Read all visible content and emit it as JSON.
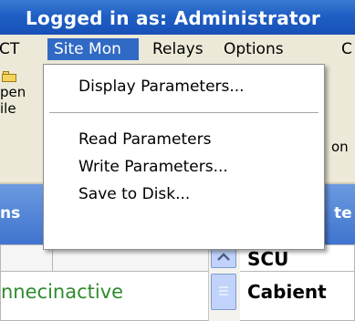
{
  "title_bar": {
    "text": "Logged in as: Administrator"
  },
  "menu_bar": {
    "items": [
      {
        "label": "CT",
        "active": false
      },
      {
        "label": "Site Mon",
        "active": true
      },
      {
        "label": "Relays",
        "active": false
      },
      {
        "label": "Options",
        "active": false
      },
      {
        "label": "C",
        "active": false
      }
    ]
  },
  "toolbar": {
    "open_button": {
      "line1": "pen",
      "line2": "ile",
      "icon": "folder-icon"
    },
    "right_button": {
      "label": "on"
    }
  },
  "grid": {
    "header_left": "ns",
    "header_right": "te",
    "row1": {
      "right": "SCU"
    },
    "row2": {
      "left": "nnecinactive",
      "right": "Cabient"
    },
    "scrollbar": {
      "up_icon": "arrow-up-icon",
      "thumb_icon": "scroll-grip-icon"
    },
    "colors": {
      "status_text": "#2e8b2e",
      "header": "#3f74cf"
    }
  },
  "dropdown": {
    "items": [
      {
        "label": "Display Parameters..."
      },
      {
        "label": "Read Parameters"
      },
      {
        "label": "Write Parameters..."
      },
      {
        "label": "Save to Disk..."
      }
    ]
  },
  "colors": {
    "title_bar": "#1f5fc4",
    "menu_highlight": "#316ac5",
    "chrome": "#ece9d8"
  }
}
